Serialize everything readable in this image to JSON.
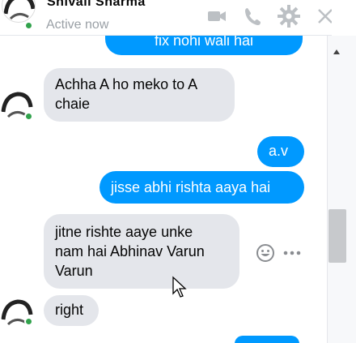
{
  "header": {
    "contact_name": "Shivali Sharma",
    "status": "Active now"
  },
  "messages": {
    "top_partial": "fix nohi wali hai",
    "m1": "Achha A ho meko to A\nchaie",
    "m2": "a.v",
    "m3": "jisse abhi rishta aaya hai",
    "m4": "jitne rishte aaye unke\nnam hai Abhinav Varun\nVarun",
    "m5": "right"
  },
  "colors": {
    "outgoing": "#0099ff",
    "incoming": "#e4e6eb",
    "presence": "#31a24c",
    "icon": "#bcc0c4"
  }
}
